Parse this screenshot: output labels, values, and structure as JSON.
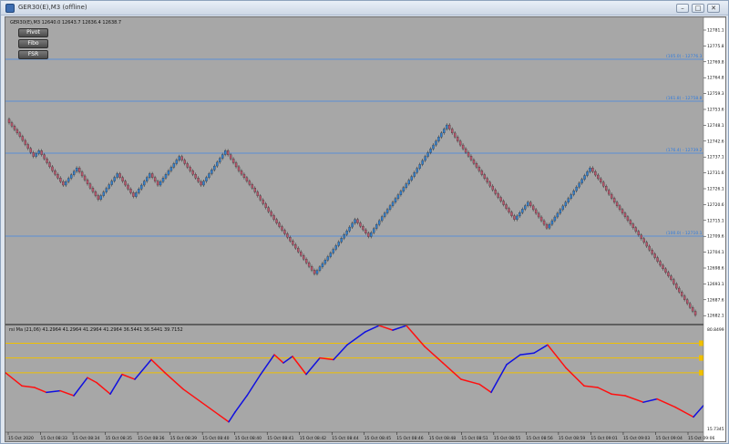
{
  "window": {
    "title": "GER30(E),M3 (offline)",
    "buttons": {
      "minimize": "–",
      "restore": "□",
      "close": "✕"
    }
  },
  "symbol_info": "GER30(E),M3  12640.0 12643.7 12636.4 12638.7",
  "toolbar": {
    "pivot": "Pivot",
    "fibo": "Fibo",
    "fsr": "FSR"
  },
  "indicator_label": "rsi Ma (21,06) 41.2964 41.2964 41.2964 41.2964 36.5441 36.5441 39.7152",
  "indicator_scale": {
    "top": "80.8499",
    "bottom": "15.7345"
  },
  "price_scale": {
    "labels": [
      "12781.1",
      "12775.8",
      "12769.8",
      "12764.8",
      "12759.3",
      "12753.6",
      "12748.1",
      "12742.6",
      "12737.1",
      "12731.6",
      "12726.1",
      "12720.6",
      "12715.1",
      "12709.6",
      "12704.1",
      "12698.6",
      "12693.1",
      "12687.6",
      "12682.1"
    ]
  },
  "level_labels": [
    "(105.0) - 12776.3",
    "(161.8) - 12758.8",
    "(176.4) - 12739.2",
    "(100.0) - 12710.1"
  ],
  "time_labels": [
    "15 Oct 2020",
    "15 Oct 08:33",
    "15 Oct 08:34",
    "15 Oct 08:35",
    "15 Oct 08:36",
    "15 Oct 08:39",
    "15 Oct 08:40",
    "15 Oct 08:40",
    "15 Oct 08:41",
    "15 Oct 08:42",
    "15 Oct 08:44",
    "15 Oct 08:45",
    "15 Oct 08:46",
    "15 Oct 08:48",
    "15 Oct 08:51",
    "15 Oct 08:55",
    "15 Oct 08:56",
    "15 Oct 08:59",
    "15 Oct 09:01",
    "15 Oct 09:03",
    "15 Oct 09:04",
    "15 Oct 09:06"
  ],
  "colors": {
    "background": "#a7a7a7",
    "bull": "#2f7fd0",
    "bear": "#b8556c",
    "level_line": "#5b8fd6",
    "rsi_up": "#1010e0",
    "rsi_down": "#ff1010",
    "band_line": "#f0c000"
  },
  "chart_data": {
    "type": "candlestick",
    "close_path": [
      12751,
      12745,
      12738,
      12740,
      12733,
      12728,
      12734,
      12727,
      12723,
      12732,
      12728,
      12724,
      12732,
      12728,
      12738,
      12728,
      12740,
      12733,
      12727,
      12716,
      12706,
      12697,
      12703,
      12712,
      12716,
      12710,
      12717,
      12722,
      12731,
      12738,
      12742,
      12749,
      12742,
      12733,
      12725,
      12716,
      12722,
      12713,
      12722,
      12734,
      12729,
      12722,
      12708,
      12700,
      12695,
      12692,
      12682.6
    ]
  }
}
